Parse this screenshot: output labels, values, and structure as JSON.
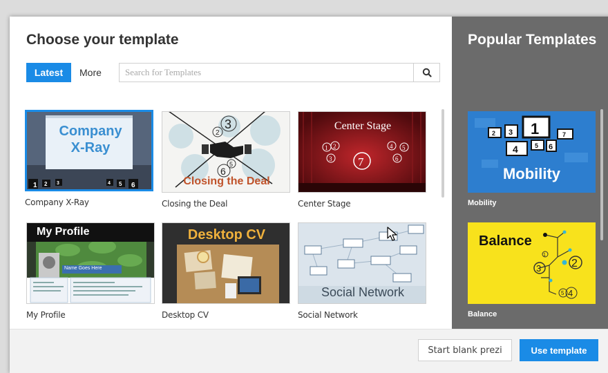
{
  "header": {
    "title": "Choose your template",
    "tabs": [
      {
        "label": "Latest",
        "active": true
      },
      {
        "label": "More",
        "active": false
      }
    ]
  },
  "search": {
    "placeholder": "Search for Templates",
    "icon": "search-icon"
  },
  "templates": [
    {
      "label": "Company X-Ray",
      "thumb_title": "Company X-Ray",
      "thumb_numbers": [
        "1",
        "2",
        "3",
        "4",
        "5",
        "6"
      ],
      "selected": true
    },
    {
      "label": "Closing the Deal",
      "thumb_title": "Closing the Deal",
      "thumb_numbers": [
        "2",
        "3",
        "6",
        "5"
      ]
    },
    {
      "label": "Center Stage",
      "thumb_title": "Center Stage",
      "thumb_numbers": [
        "1",
        "2",
        "3",
        "4",
        "5",
        "6",
        "7"
      ]
    },
    {
      "label": "My Profile",
      "thumb_title": "My Profile",
      "thumb_subtitle": "Name Goes Here"
    },
    {
      "label": "Desktop CV",
      "thumb_title": "Desktop CV"
    },
    {
      "label": "Social Network",
      "thumb_title": "Social Network"
    }
  ],
  "sidebar": {
    "title": "Popular Templates",
    "items": [
      {
        "label": "Mobility",
        "thumb_title": "Mobility",
        "thumb_numbers": [
          "2",
          "3",
          "1",
          "7",
          "4",
          "5",
          "6"
        ]
      },
      {
        "label": "Balance",
        "thumb_title": "Balance",
        "thumb_numbers": [
          "1",
          "2",
          "3",
          "4",
          "5"
        ]
      }
    ]
  },
  "footer": {
    "blank_label": "Start blank prezi",
    "use_label": "Use template"
  },
  "colors": {
    "accent": "#1a8be6",
    "sidebar": "#6b6b6b",
    "footer": "#f2f2f2"
  }
}
